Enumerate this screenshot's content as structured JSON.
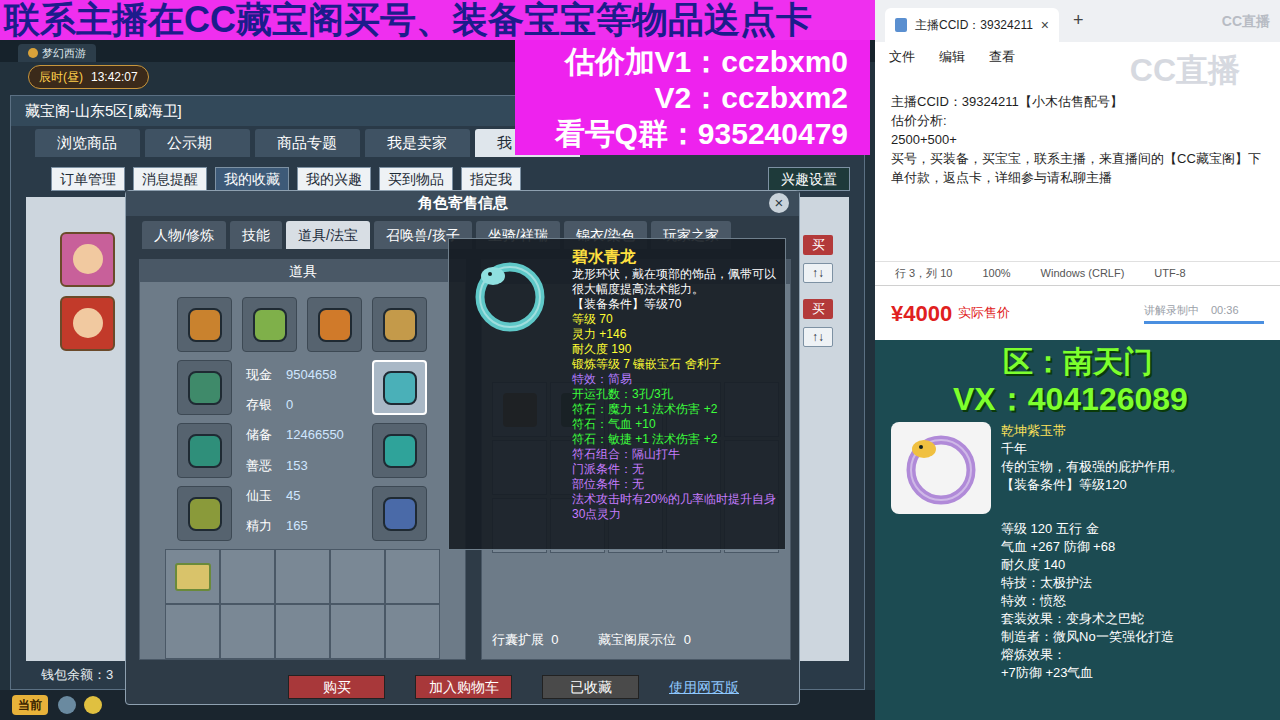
{
  "banner": {
    "text": "联系主播在CC藏宝阁买号、装备宝宝等物品送点卡"
  },
  "promo": {
    "lines": [
      "估价加V1：cczbxm0",
      "V2：cczbxm2",
      "看号Q群：935240479"
    ]
  },
  "game": {
    "window_tab": "梦幻西游",
    "time": {
      "period": "辰时(昼)",
      "clock": "13:42:07"
    },
    "title": "藏宝阁-山东5区[威海卫]",
    "tabs": [
      {
        "label": "浏览商品",
        "selected": false
      },
      {
        "label": "公示期",
        "selected": false
      },
      {
        "label": "商品专题",
        "selected": false
      },
      {
        "label": "我是卖家",
        "selected": false
      },
      {
        "label": "我",
        "selected": true
      }
    ],
    "subtabs": [
      {
        "label": "订单管理",
        "selected": false
      },
      {
        "label": "消息提醒",
        "selected": false
      },
      {
        "label": "我的收藏",
        "selected": true
      },
      {
        "label": "我的兴趣",
        "selected": false
      },
      {
        "label": "买到物品",
        "selected": false
      },
      {
        "label": "指定我",
        "selected": false
      }
    ],
    "interest_button": "兴趣设置",
    "listings": [
      {
        "buy": "买",
        "sort": "↑↓"
      },
      {
        "buy": "买",
        "sort": "↑↓"
      }
    ],
    "wallet": "钱包余额：3",
    "chat_channel": "当前"
  },
  "dialog": {
    "title": "角色寄售信息",
    "close": "×",
    "tabs": [
      {
        "label": "人物/修炼",
        "selected": false
      },
      {
        "label": "技能",
        "selected": false
      },
      {
        "label": "道具/法宝",
        "selected": true
      },
      {
        "label": "召唤兽/孩子",
        "selected": false
      },
      {
        "label": "坐骑/祥瑞",
        "selected": false
      },
      {
        "label": "锦衣/染色",
        "selected": false
      },
      {
        "label": "玩家之家",
        "selected": false
      }
    ],
    "section": "道具",
    "equipment": [
      {
        "selected": false
      },
      {
        "selected": false
      },
      {
        "selected": false
      },
      {
        "selected": false
      },
      {
        "selected": false
      },
      {
        "selected": false
      },
      {
        "selected": false
      },
      {
        "selected": true
      },
      {
        "selected": false
      },
      {
        "selected": false
      }
    ],
    "stats": [
      {
        "label": "现金",
        "value": "9504658"
      },
      {
        "label": "存银",
        "value": "0"
      },
      {
        "label": "储备",
        "value": "12466550"
      },
      {
        "label": "善恶",
        "value": "153"
      },
      {
        "label": "仙玉",
        "value": "45"
      },
      {
        "label": "精力",
        "value": "165"
      }
    ],
    "bag_slots": [
      {
        "filled": true
      },
      {
        "filled": false
      },
      {
        "filled": false
      },
      {
        "filled": false
      },
      {
        "filled": false
      },
      {
        "filled": false
      },
      {
        "filled": false
      },
      {
        "filled": false
      },
      {
        "filled": false
      },
      {
        "filled": false
      }
    ],
    "storage_slots": [
      {
        "filled": true
      },
      {
        "filled": true
      },
      {
        "filled": false
      },
      {
        "filled": false
      },
      {
        "filled": false
      },
      {
        "filled": false
      },
      {
        "filled": false
      },
      {
        "filled": false
      },
      {
        "filled": false
      },
      {
        "filled": false
      },
      {
        "filled": false
      },
      {
        "filled": false
      },
      {
        "filled": false
      },
      {
        "filled": false
      },
      {
        "filled": false
      }
    ],
    "extension": {
      "label": "行囊扩展",
      "value": "0"
    },
    "showcase": {
      "label": "藏宝阁展示位",
      "value": "0"
    },
    "buttons": [
      {
        "label": "购买",
        "kind": "primary"
      },
      {
        "label": "加入购物车",
        "kind": "primary"
      },
      {
        "label": "已收藏",
        "kind": "muted"
      }
    ],
    "link": "使用网页版"
  },
  "tooltip": {
    "name": "碧水青龙",
    "lines": [
      {
        "text": "龙形环状，戴在项部的饰品，佩带可以很大幅度提高法术能力。",
        "color": "#ffffff"
      },
      {
        "text": "【装备条件】等级70",
        "color": "#ffffff"
      },
      {
        "text": "等级 70",
        "color": "#ffff33"
      },
      {
        "text": "灵力 +146",
        "color": "#ffff33"
      },
      {
        "text": "耐久度 190",
        "color": "#ffff33"
      },
      {
        "text": "锻炼等级 7  镶嵌宝石 舍利子",
        "color": "#ffff33"
      },
      {
        "text": "特效：简易",
        "color": "#b57cff"
      },
      {
        "text": "开运孔数：3孔/3孔",
        "color": "#3cff3c"
      },
      {
        "text": "符石：魔力 +1 法术伤害 +2",
        "color": "#3cff3c"
      },
      {
        "text": "符石：气血 +10",
        "color": "#3cff3c"
      },
      {
        "text": "符石：敏捷 +1 法术伤害 +2",
        "color": "#3cff3c"
      },
      {
        "text": "符石组合：隔山打牛",
        "color": "#c77dff"
      },
      {
        "text": "门派条件：无",
        "color": "#c77dff"
      },
      {
        "text": "部位条件：无",
        "color": "#c77dff"
      },
      {
        "text": "法术攻击时有20%的几率临时提升自身30点灵力",
        "color": "#c77dff"
      }
    ]
  },
  "notepad": {
    "tab_title": "主播CCID：39324211",
    "close": "×",
    "new_tab": "+",
    "menu": [
      "文件",
      "编辑",
      "查看"
    ],
    "lines": [
      "主播CCID：39324211【小木估售配号】",
      "估价分析:",
      "2500+500+",
      "买号，买装备，买宝宝，联系主播，来直播间的【CC藏宝阁】下单付款，返点卡，详细参与请私聊主播"
    ],
    "status": [
      "行 3，列 10",
      "100%",
      "Windows (CRLF)",
      "UTF-8"
    ]
  },
  "watermark": "CC直播",
  "price": {
    "amount": "¥4000",
    "label": "实际售价",
    "recording": "讲解录制中",
    "timer": "00:36"
  },
  "item_panel": {
    "server": "区：南天门",
    "contact": "VX：404126089",
    "name": "乾坤紫玉带",
    "description": [
      "千年",
      "传的宝物，有极强的庇护作用。",
      "【装备条件】等级120"
    ],
    "lines": [
      "等级 120 五行 金",
      "气血 +267 防御 +68",
      "耐久度 140",
      "特技：太极护法",
      "特效：愤怒",
      "套装效果：变身术之巴蛇",
      "制造者：微风No一笑强化打造",
      "熔炼效果：",
      "+7防御 +23气血"
    ]
  }
}
